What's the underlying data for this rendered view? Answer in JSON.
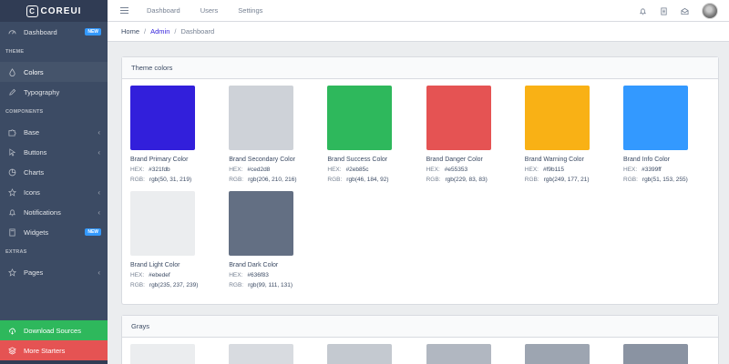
{
  "brand": {
    "logo_letter": "C",
    "name": "COREUI"
  },
  "sidebar": {
    "items": [
      {
        "label": "Dashboard",
        "badge": "NEW",
        "icon": "speedometer-icon"
      },
      {
        "section": "THEME"
      },
      {
        "label": "Colors",
        "icon": "drop-icon"
      },
      {
        "label": "Typography",
        "icon": "pencil-icon"
      },
      {
        "section": "COMPONENTS"
      },
      {
        "label": "Base",
        "icon": "puzzle-icon"
      },
      {
        "label": "Buttons",
        "icon": "cursor-icon"
      },
      {
        "label": "Charts",
        "icon": "chart-pie-icon"
      },
      {
        "label": "Icons",
        "icon": "star-icon"
      },
      {
        "label": "Notifications",
        "icon": "bell-icon"
      },
      {
        "label": "Widgets",
        "badge": "NEW",
        "icon": "calculator-icon"
      },
      {
        "section": "EXTRAS"
      },
      {
        "label": "Pages",
        "icon": "star-icon"
      }
    ],
    "download": "Download Sources",
    "starters": "More Starters"
  },
  "header": {
    "nav": [
      "Dashboard",
      "Users",
      "Settings"
    ]
  },
  "breadcrumb": {
    "home": "Home",
    "admin": "Admin",
    "current": "Dashboard"
  },
  "theme_card": {
    "title": "Theme colors",
    "hex_label": "HEX:",
    "rgb_label": "RGB:",
    "colors": [
      {
        "name": "Brand Primary Color",
        "hex": "#321fdb",
        "rgb": "rgb(50, 31, 219)",
        "swatch": "#321fdb"
      },
      {
        "name": "Brand Secondary Color",
        "hex": "#ced2d8",
        "rgb": "rgb(206, 210, 216)",
        "swatch": "#ced2d8"
      },
      {
        "name": "Brand Success Color",
        "hex": "#2eb85c",
        "rgb": "rgb(46, 184, 92)",
        "swatch": "#2eb85c"
      },
      {
        "name": "Brand Danger Color",
        "hex": "#e55353",
        "rgb": "rgb(229, 83, 83)",
        "swatch": "#e55353"
      },
      {
        "name": "Brand Warning Color",
        "hex": "#f9b115",
        "rgb": "rgb(249, 177, 21)",
        "swatch": "#f9b115"
      },
      {
        "name": "Brand Info Color",
        "hex": "#3399ff",
        "rgb": "rgb(51, 153, 255)",
        "swatch": "#3399ff"
      },
      {
        "name": "Brand Light Color",
        "hex": "#ebedef",
        "rgb": "rgb(235, 237, 239)",
        "swatch": "#ebedef"
      },
      {
        "name": "Brand Dark Color",
        "hex": "#636f83",
        "rgb": "rgb(99, 111, 131)",
        "swatch": "#636f83"
      }
    ]
  },
  "grays_card": {
    "title": "Grays",
    "swatches": [
      "#ebedef",
      "#d8dbe0",
      "#c4c9d0",
      "#b1b7c1",
      "#9da5b1",
      "#8a93a2"
    ]
  }
}
